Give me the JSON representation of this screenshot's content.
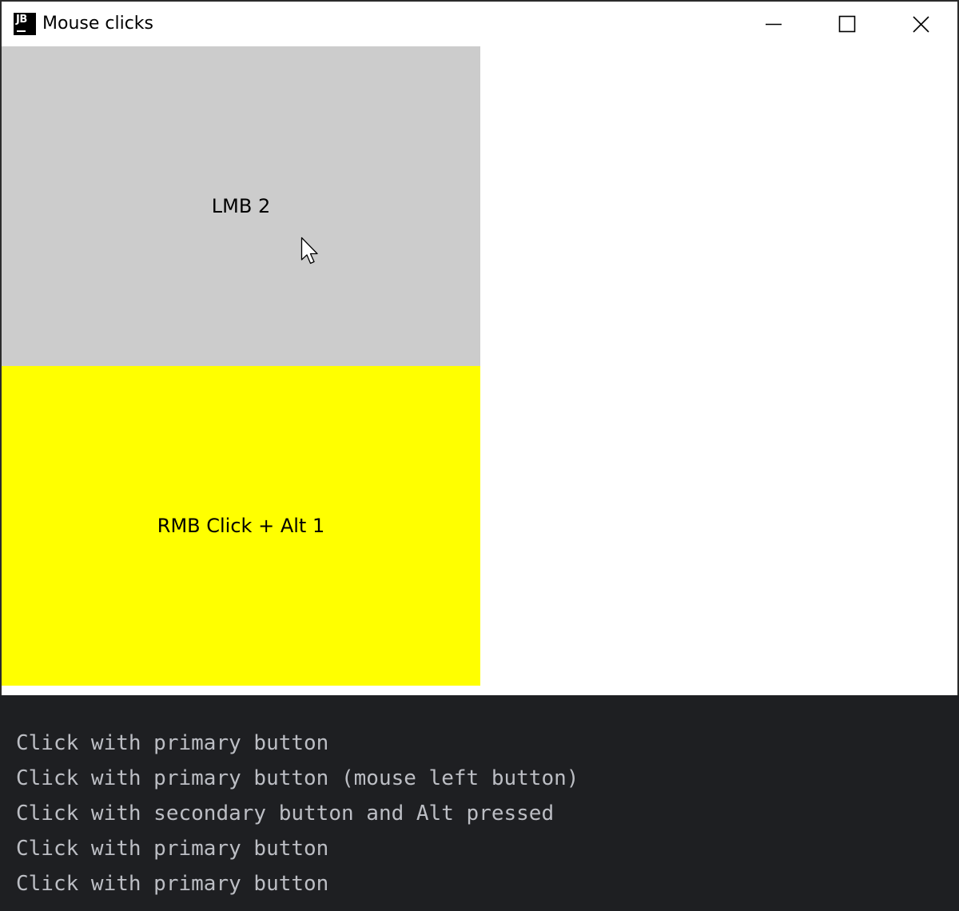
{
  "window": {
    "title": "Mouse clicks",
    "icon_text": "JB"
  },
  "panels": {
    "top": {
      "label": "LMB 2",
      "color": "#cccccc"
    },
    "bottom": {
      "label": "RMB Click + Alt 1",
      "color": "#ffff00"
    }
  },
  "console": {
    "lines": [
      "Click with primary button",
      "Click with primary button (mouse left button)",
      "Click with secondary button and Alt pressed",
      "Click with primary button",
      "Click with primary button"
    ]
  },
  "icons": {
    "app": "jetbrains-icon",
    "minimize": "minimize-icon",
    "maximize": "maximize-icon",
    "close": "close-icon",
    "cursor": "mouse-pointer-icon"
  }
}
